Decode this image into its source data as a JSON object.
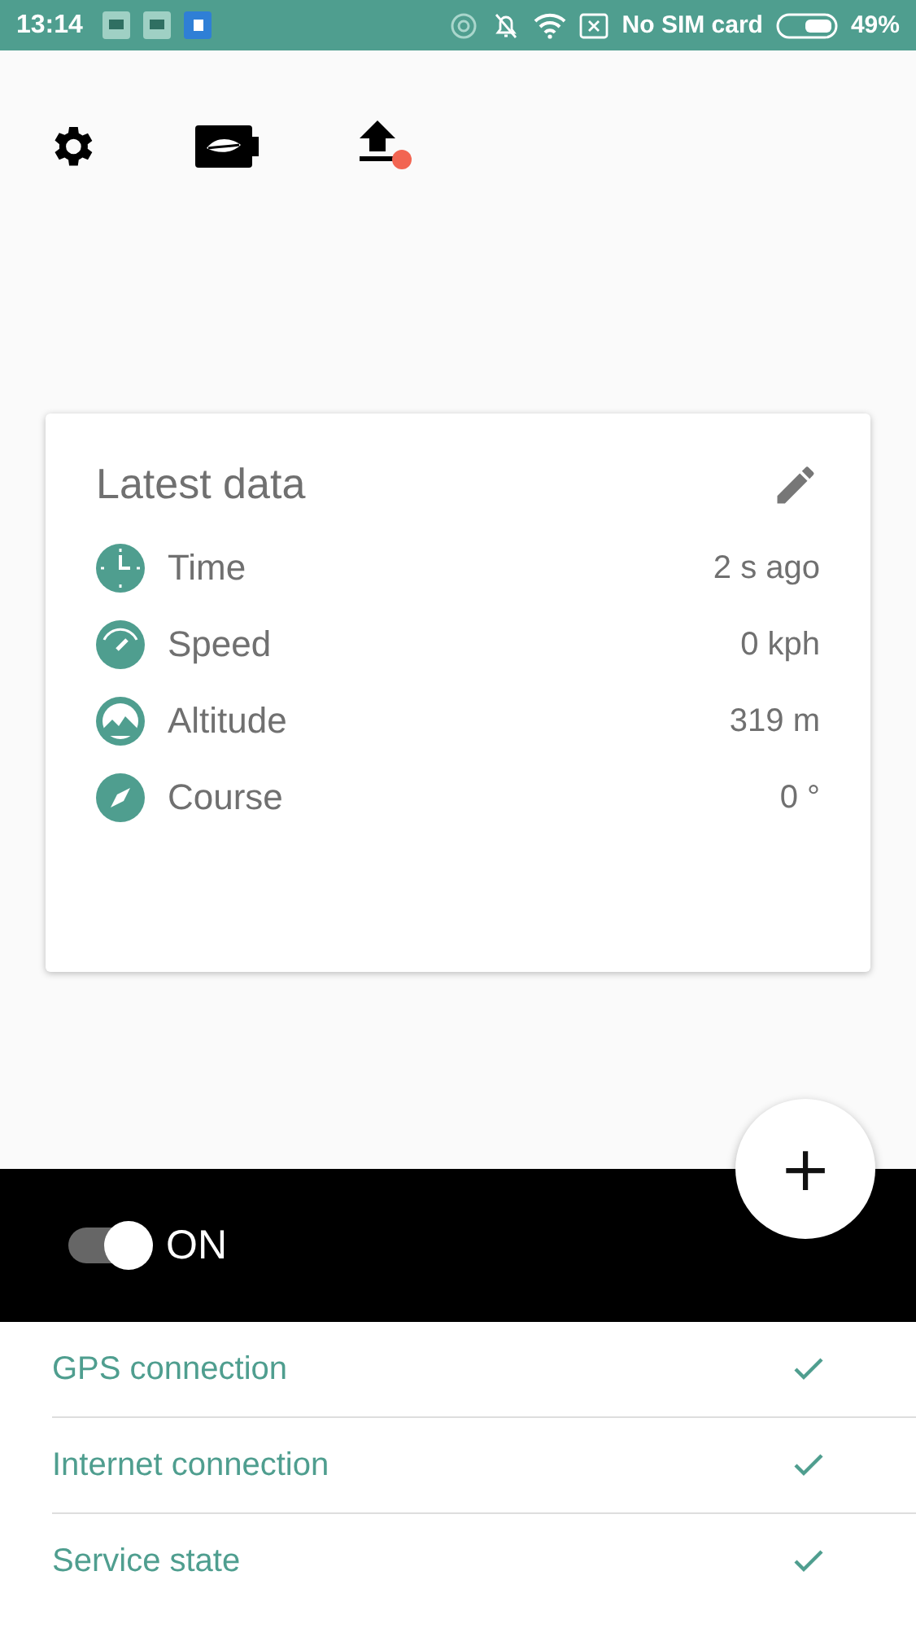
{
  "status_bar": {
    "time": "13:14",
    "sim": "No SIM card",
    "battery": "49%"
  },
  "toolbar": {
    "upload_pending": true
  },
  "card": {
    "title": "Latest data",
    "rows": [
      {
        "kind": "time",
        "label": "Time",
        "value": "2 s ago"
      },
      {
        "kind": "speed",
        "label": "Speed",
        "value": "0 kph"
      },
      {
        "kind": "altitude",
        "label": "Altitude",
        "value": "319 m"
      },
      {
        "kind": "course",
        "label": "Course",
        "value": "0 °"
      }
    ]
  },
  "fab": {
    "label": "+"
  },
  "tracking": {
    "label": "ON",
    "on": true
  },
  "checks": [
    {
      "label": "GPS connection",
      "checked": true
    },
    {
      "label": "Internet connection",
      "checked": true
    },
    {
      "label": "Service state",
      "checked": true
    }
  ]
}
